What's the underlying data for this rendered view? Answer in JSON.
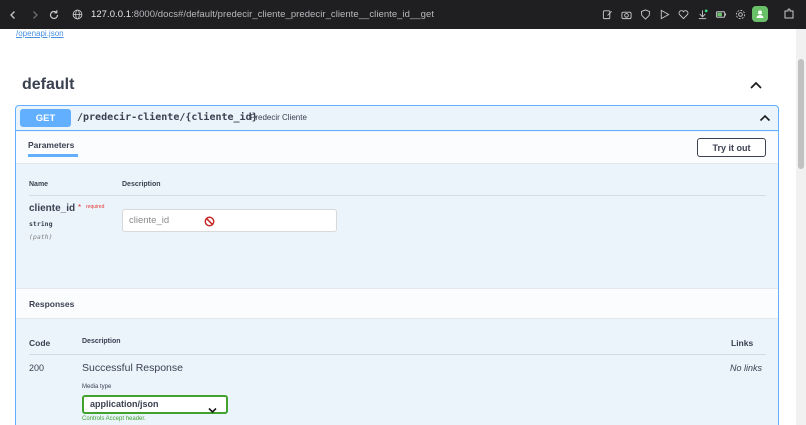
{
  "browser": {
    "url_host": "127.0.0.1",
    "url_rest": ":8000/docs#/default/predecir_cliente_predecir_cliente__cliente_id__get"
  },
  "page": {
    "openapi_link": "/openapi.json",
    "section_title": "default",
    "operation": {
      "method": "GET",
      "path": "/predecir-cliente/{cliente_id}",
      "summary": "Predecir Cliente",
      "params_tab": "Parameters",
      "try_button": "Try it out",
      "columns": {
        "name": "Name",
        "description": "Description"
      },
      "parameter": {
        "name": "cliente_id",
        "required_star": "*",
        "required_label": "required",
        "type": "string",
        "location": "(path)",
        "placeholder": "cliente_id"
      },
      "responses": {
        "title": "Responses",
        "columns": {
          "code": "Code",
          "description": "Description",
          "links": "Links"
        },
        "rows": [
          {
            "code": "200",
            "description": "Successful Response",
            "links": "No links",
            "media_type_label": "Media type",
            "media_type_value": "application/json",
            "controls_text": "Controls Accept header."
          }
        ]
      }
    }
  },
  "colors": {
    "get_accent": "#61affe",
    "opblock_bg": "#ebf3fb",
    "text": "#3b4151",
    "required": "#e53935",
    "select_border": "#41a230"
  }
}
